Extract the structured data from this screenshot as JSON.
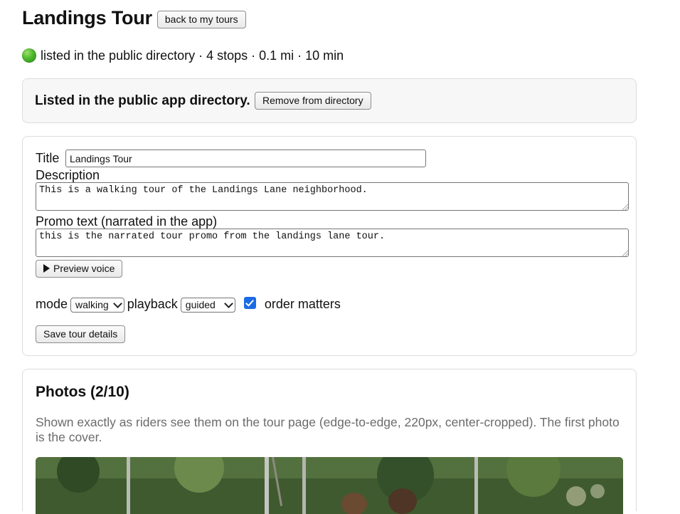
{
  "header": {
    "title": "Landings Tour",
    "back_label": "back to my tours"
  },
  "status": {
    "indicator_color": "#4cb82b",
    "text": "listed in the public directory · 4 stops · 0.1 mi · 10 min"
  },
  "directory": {
    "message": "Listed in the public app directory.",
    "remove_label": "Remove from directory"
  },
  "details": {
    "title_label": "Title",
    "title_value": "Landings Tour",
    "description_label": "Description",
    "description_value": "This is a walking tour of the Landings Lane neighborhood.",
    "promo_label": "Promo text (narrated in the app)",
    "promo_value": "this is the narrated tour promo from the landings lane tour.",
    "preview_label": "Preview voice",
    "mode_label": "mode",
    "mode_value": "walking",
    "playback_label": "playback",
    "playback_value": "guided",
    "order_checked": true,
    "order_label": "order matters",
    "save_label": "Save tour details"
  },
  "photos": {
    "title": "Photos (2/10)",
    "description": "Shown exactly as riders see them on the tour page (edge-to-edge, 220px, center-cropped). The first photo is the cover."
  },
  "colors": {
    "accent": "#1a6be6",
    "muted_text": "#6b6b6b",
    "card_border": "#dcdcdc"
  }
}
